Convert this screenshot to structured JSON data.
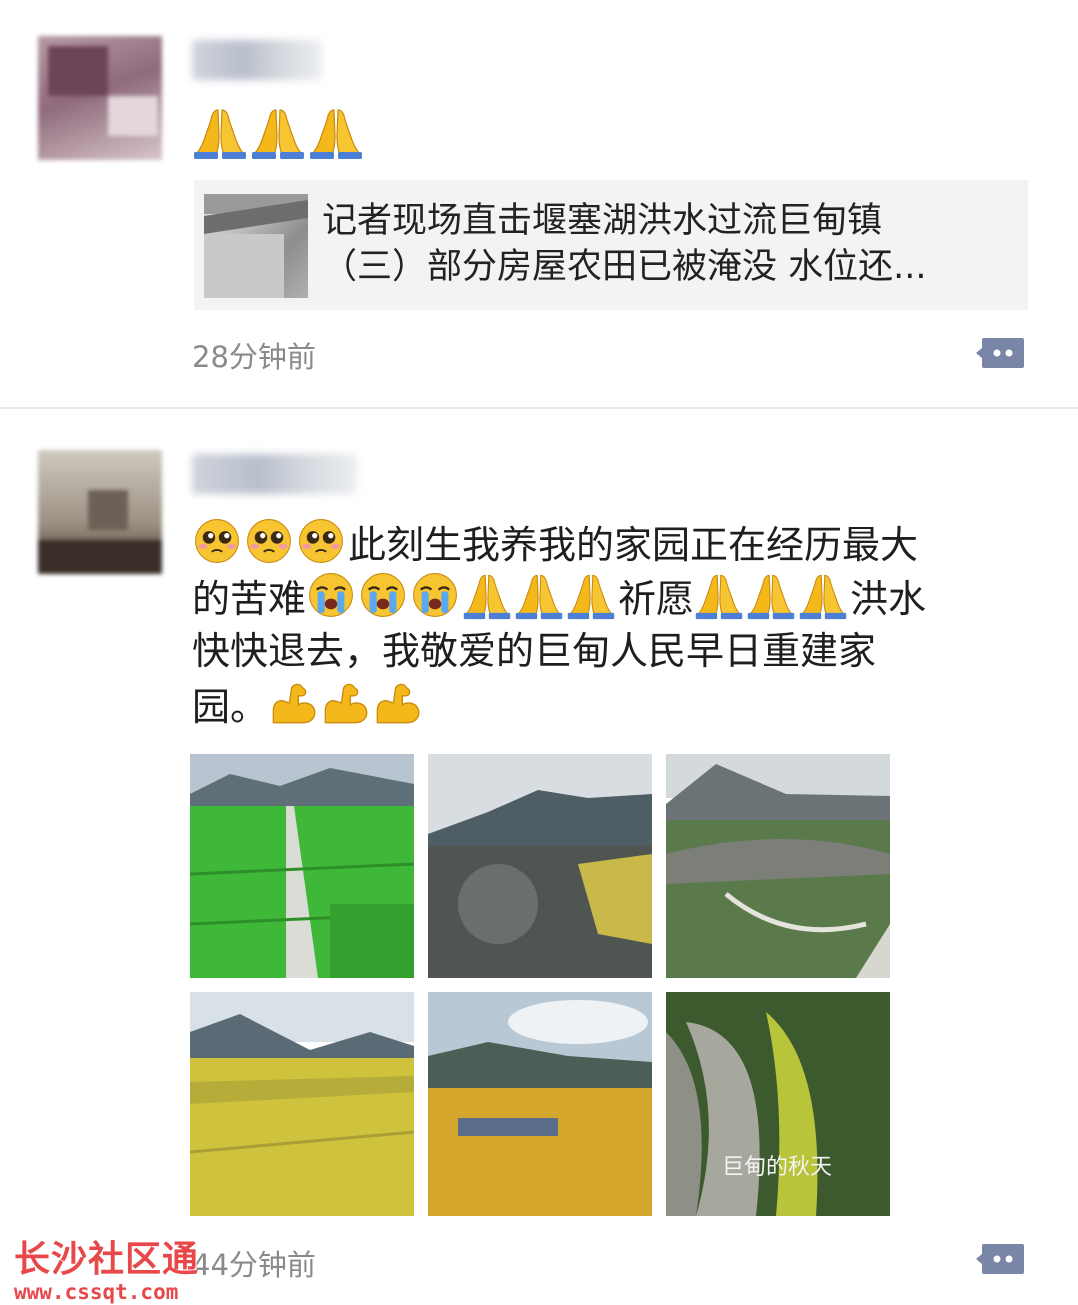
{
  "posts": [
    {
      "nickname": "",
      "emoji": [
        "folded-hands",
        "folded-hands",
        "folded-hands"
      ],
      "link": {
        "title_line1": "记者现场直击堰塞湖洪水过流巨甸镇",
        "title_line2": "（三）部分房屋农田已被淹没 水位还..."
      },
      "time": "28分钟前"
    },
    {
      "nickname": "",
      "text": {
        "line1_text": "此刻生我养我的家园正在经历最大",
        "line2_a": "的苦难",
        "line2_b": "祈愿",
        "line2_c": "洪水",
        "line3": "快快退去，我敬爱的巨甸人民早日重建家",
        "line4": "园。"
      },
      "photos": [
        "green-rice-fields-road",
        "village-aerial-mountains",
        "village-river-road",
        "golden-fields-lake",
        "golden-fields-cloudy-mountains",
        "village-terraced-fields"
      ],
      "photo_caption": "巨甸的秋天",
      "time": "44分钟前"
    }
  ],
  "watermark": {
    "title": "长沙社区通",
    "url": "www.cssqt.com"
  },
  "colors": {
    "accent_link_bg": "#f3f3f5",
    "time_text": "#8a8a8a",
    "comment_icon": "#7a86a8",
    "watermark": "#e8484a"
  }
}
